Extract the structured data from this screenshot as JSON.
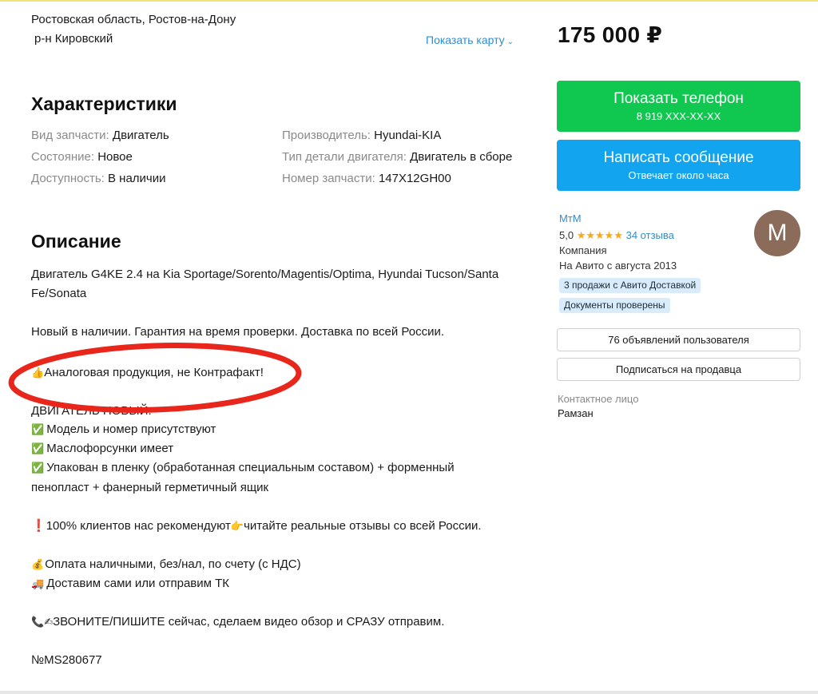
{
  "location": {
    "region": "Ростовская область, Ростов-на-Дону",
    "district": "р-н Кировский",
    "show_map": "Показать карту"
  },
  "specs": {
    "title": "Характеристики",
    "left": [
      {
        "key": "Вид запчасти:",
        "value": "Двигатель"
      },
      {
        "key": "Состояние:",
        "value": "Новое"
      },
      {
        "key": "Доступность:",
        "value": "В наличии"
      }
    ],
    "right": [
      {
        "key": "Производитель:",
        "value": "Hyundai-KIA"
      },
      {
        "key": "Тип детали двигателя:",
        "value": "Двигатель в сборе"
      },
      {
        "key": "Номер запчасти:",
        "value": "147X12GH00"
      }
    ]
  },
  "description": {
    "title": "Описание",
    "line1": "Двигатель G4KE 2.4 на Kia Sportage/Sorento/Magentis/Optima, Hyundai Tucson/Santa Fe/Sonata",
    "line2": "Новый в наличии. Гарантия на время проверки. Доставка по всей России.",
    "line3": "Аналоговая продукция, не Контрафакт!",
    "line4": "ДВИГАТЕЛЬ НОВЫЙ:",
    "check1": "Модель и номер присутствуют",
    "check2": "Маслофорсунки имеет",
    "check3": "Упакован в пленку (обработанная специальным составом) + форменный пенопласт + фанерный герметичный ящик",
    "line5a": "100% клиентов нас рекомендуют",
    "line5b": "читайте реальные отзывы со всей России.",
    "line6": "Оплата наличными, без/нал, по счету (с НДС)",
    "line7": "Доставим сами или отправим ТК",
    "line8": "ЗВОНИТЕ/ПИШИТЕ сейчас, сделаем видео обзор и СРАЗУ отправим.",
    "line9": "№MS280677"
  },
  "price": "175 000 ₽",
  "phone_button": {
    "label": "Показать телефон",
    "sub": "8 919 XXX-XX-XX"
  },
  "message_button": {
    "label": "Написать сообщение",
    "sub": "Отвечает около часа"
  },
  "seller": {
    "name": "МтМ",
    "rating": "5,0",
    "stars": "★★★★★",
    "reviews": "34 отзыва",
    "type": "Компания",
    "since": "На Авито с августа 2013",
    "badge1": "3 продажи с Авито Доставкой",
    "badge2": "Документы проверены",
    "avatar_letter": "M"
  },
  "user_ads_button": "76 объявлений пользователя",
  "subscribe_button": "Подписаться на продавца",
  "contact": {
    "label": "Контактное лицо",
    "name": "Рамзан"
  },
  "colors": {
    "green": "#10c850",
    "blue": "#12a4ef",
    "link": "#2d8fd1",
    "annotation": "#e8261b"
  }
}
